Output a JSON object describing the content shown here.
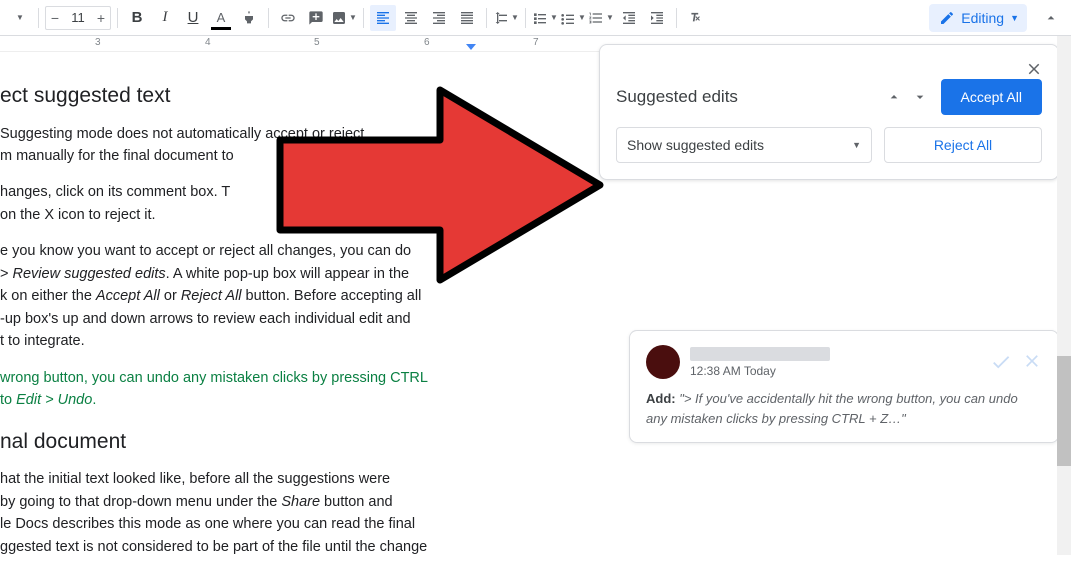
{
  "toolbar": {
    "font_size": "11",
    "editing_label": "Editing"
  },
  "ruler": {
    "labels": [
      "3",
      "4",
      "5",
      "6",
      "7"
    ]
  },
  "document": {
    "h1_partial": "ect suggested text",
    "p1a": " Suggesting mode does not automatically accept or reject ",
    "p1b": "m manually for the final document to",
    "p2a": "hanges, click on its comment box. T",
    "p2b": "on the X icon to reject it.",
    "p3a": "e you know you want to accept or reject all changes, you can do ",
    "p3b_prefix": " > ",
    "p3b_italic": "Review suggested edits",
    "p3b_suffix": ". A white pop-up box will appear in the ",
    "p3c_prefix": "k on either the ",
    "p3c_it1": "Accept All",
    "p3c_mid": " or ",
    "p3c_it2": "Reject All",
    "p3c_suffix": " button. Before accepting all ",
    "p3d": "-up box's up and down arrows to review each individual edit and ",
    "p3e": "t to integrate.",
    "green1": "wrong button, you can undo any mistaken clicks by pressing CTRL ",
    "green2_prefix": "to ",
    "green2_italic": "Edit > Undo",
    "green2_suffix": ".",
    "h2_partial": "nal document",
    "p4a": "hat the initial text looked like, before all the suggestions were ",
    "p4b_prefix": "by going to that drop-down menu under the ",
    "p4b_italic": "Share",
    "p4b_suffix": " button and ",
    "p4c": "le Docs describes this mode as one where you can read the final ",
    "p4d": "ggested text is not considered to be part of the file until the change "
  },
  "panel": {
    "title": "Suggested edits",
    "dropdown": "Show suggested edits",
    "accept_all": "Accept All",
    "reject_all": "Reject All"
  },
  "suggestion": {
    "time": "12:38 AM Today",
    "add_label": "Add:",
    "add_text": "\"> If you've accidentally hit the wrong button, you can undo any mistaken clicks by pressing CTRL + Z…\""
  }
}
